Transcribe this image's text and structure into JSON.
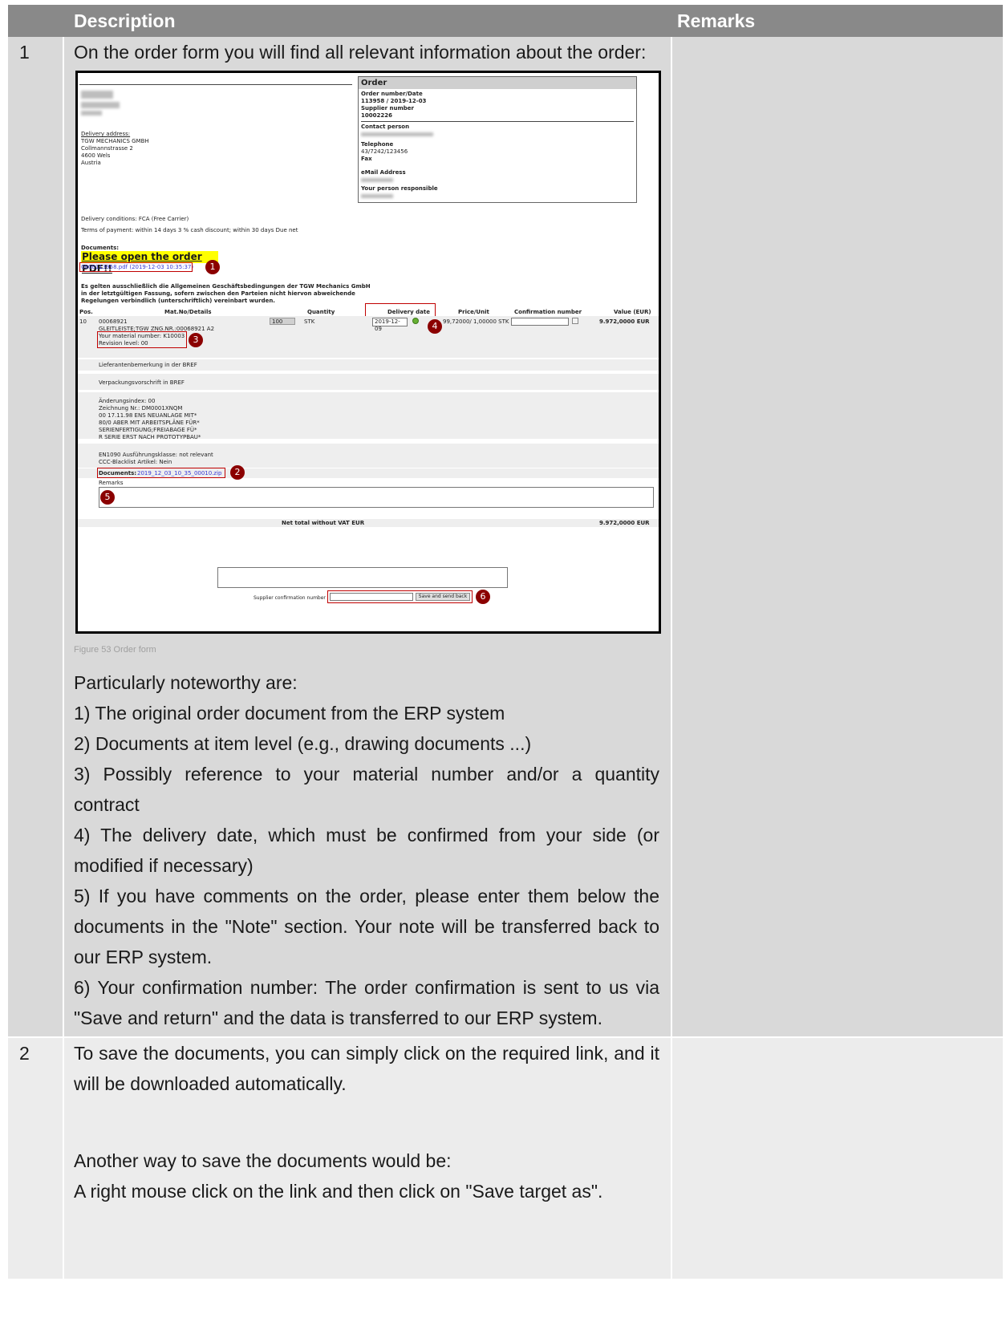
{
  "header": {
    "description": "Description",
    "remarks": "Remarks"
  },
  "steps": [
    {
      "number": "1",
      "intro": "On the order form you will find all relevant information about the order:",
      "caption": "Figure 53 Order form",
      "noteworthy_title": "Particularly noteworthy are:",
      "points": [
        "1) The original order document from the ERP system",
        "2) Documents at item level (e.g., drawing documents ...)",
        "3) Possibly reference to your material number and/or a quantity contract",
        "4) The delivery date, which must be confirmed from your side (or modified if necessary)",
        "5) If you have comments on the order, please enter them below the documents in the \"Note\" section. Your note will be transferred back to our ERP system.",
        "6) Your confirmation number: The order confirmation is sent to us via \"Save and return\" and the data is transferred to our ERP system."
      ]
    },
    {
      "number": "2",
      "paragraph1": "To save the documents, you can simply click on the required link, and it will be downloaded automatically.",
      "paragraph2_line1": "Another way to save the documents would be:",
      "paragraph2_line2": "A right mouse click on the link and then click on \"Save target as\"."
    }
  ],
  "order_form": {
    "order_title": "Order",
    "order_number_label": "Order number/Date",
    "order_number_value": "113958 / 2019-12-03",
    "supplier_number_label": "Supplier number",
    "supplier_number_value": "10002226",
    "contact_label": "Contact person",
    "telephone_label": "Telephone",
    "telephone_value": "43/7242/123456",
    "fax_label": "Fax",
    "email_label": "eMail Address",
    "responsible_label": "Your person responsible",
    "delivery_address_label": "Delivery address:",
    "delivery_address_lines": [
      "TGW MECHANICS GMBH",
      "Collmannstrasse 2",
      "4600 Wels",
      "Austria"
    ],
    "delivery_conditions": "Delivery conditions: FCA (Free Carrier)",
    "terms_of_payment": "Terms of payment: within 14 days 3 % cash discount; within 30 days Due net",
    "documents_label": "Documents:",
    "open_pdf": "Please open the order PDF!!",
    "pdf_link": "0000113958.pdf (2019-12-03 10:35:37)",
    "legal_lines": [
      "Es gelten ausschließlich die Allgemeinen Geschäftsbedingungen der TGW Mechanics GmbH",
      "in der letztgültigen Fassung, sofern zwischen den Parteien nicht hiervon abweichende",
      "Regelungen verbindlich (unterschriftlich) vereinbart wurden."
    ],
    "columns": [
      "Pos.",
      "Mat.No/Details",
      "Quantity",
      "Delivery date",
      "Price/Unit",
      "Confirmation number",
      "Value (EUR)"
    ],
    "item": {
      "pos": "10",
      "material": "00068921",
      "description": "GLEITLEISTE;TGW ZNG.NR.:00068921 A2",
      "your_material": "Your material number: K10003",
      "revision": "Revision level:  00",
      "quantity": "100",
      "unit": "STK",
      "delivery_date": "2019-12-09",
      "price": "99,72000/ 1,00000 STK",
      "value": "9.972,0000 EUR"
    },
    "supplier_remark": "Lieferantenbemerkung in der BREF",
    "packaging": "Verpackungsvorschrift in BREF",
    "change_lines": [
      "Änderungsindex: 00",
      "Zeichnung Nr.: DM0001XNQM",
      "00 17.11.98 ENS NEUANLAGE MIT*",
      "80/0 ABER MIT ARBEITSPLÄNE FÜR*",
      "SERIENFERTIGUNG;FREIABAGE FÜ*",
      "R SERIE ERST NACH PROTOTYPBAU*"
    ],
    "en1090": "EN1090 Ausführungsklasse: not relevant",
    "ccc": "CCC-Blacklist Artikel: Nein",
    "item_documents_label": "Documents:",
    "item_documents_link": "2019_12_03_10_35_00010.zip",
    "remarks_label": "Remarks",
    "net_total_label": "Net total without VAT EUR",
    "net_total_value": "9.972,0000 EUR",
    "supplier_confirmation_label": "Supplier confirmation number",
    "save_button": "Save and send back",
    "badges": [
      "1",
      "2",
      "3",
      "4",
      "5",
      "6"
    ]
  }
}
